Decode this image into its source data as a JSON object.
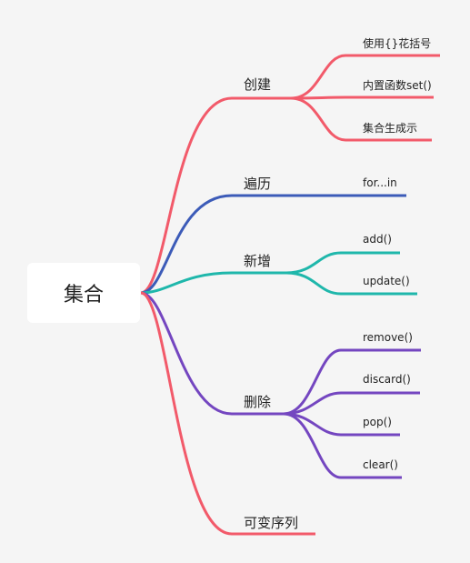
{
  "root": {
    "label": "集合"
  },
  "colors": {
    "create": "#f25a6a",
    "traverse": "#3c5bb8",
    "add": "#1fb7ab",
    "delete": "#7446c0",
    "mutable": "#f25a6a"
  },
  "branches": [
    {
      "key": "create",
      "label": "创建",
      "children": [
        "使用{}花括号",
        "内置函数set()",
        "集合生成示"
      ]
    },
    {
      "key": "traverse",
      "label": "遍历",
      "children": [
        "for...in"
      ]
    },
    {
      "key": "add",
      "label": "新增",
      "children": [
        "add()",
        "update()"
      ]
    },
    {
      "key": "delete",
      "label": "删除",
      "children": [
        "remove()",
        "discard()",
        "pop()",
        "clear()"
      ]
    },
    {
      "key": "mutable",
      "label": "可变序列",
      "children": []
    }
  ]
}
